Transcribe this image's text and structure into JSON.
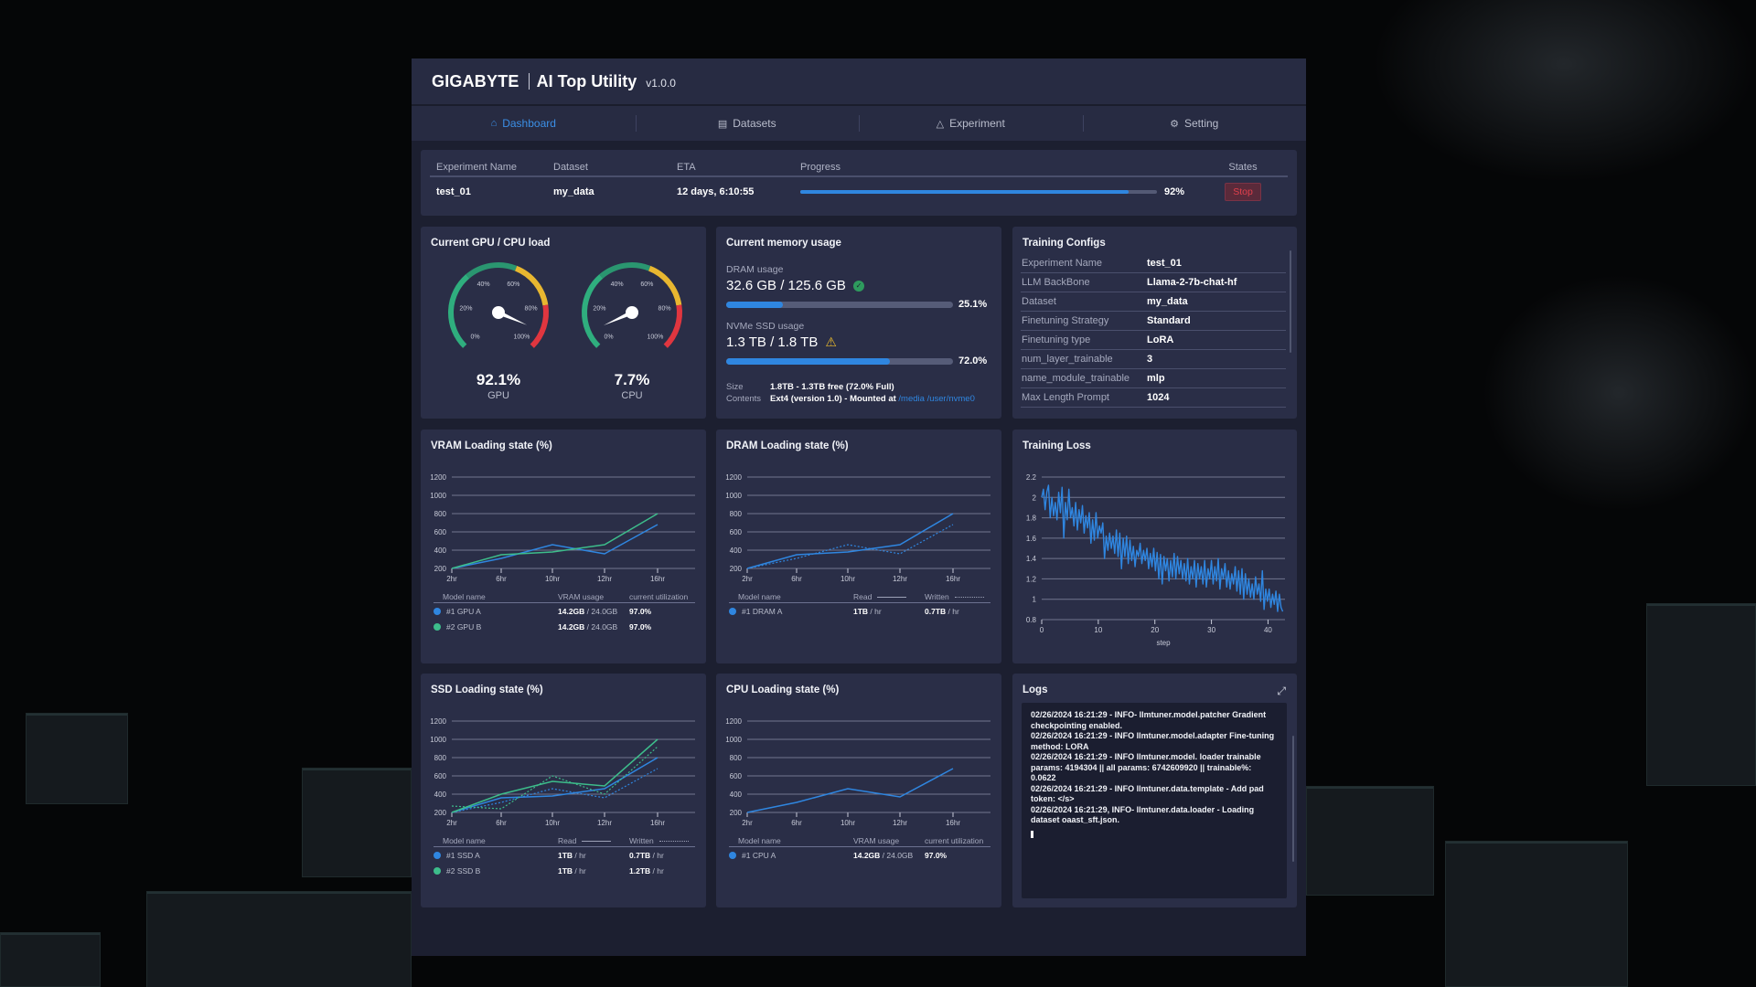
{
  "app": {
    "brand": "GIGABYTE",
    "name": "AI Top Utility",
    "version": "v1.0.0"
  },
  "nav": {
    "tabs": [
      {
        "label": "Dashboard",
        "icon": "home-icon",
        "active": true
      },
      {
        "label": "Datasets",
        "icon": "database-icon",
        "active": false
      },
      {
        "label": "Experiment",
        "icon": "flask-icon",
        "active": false
      },
      {
        "label": "Setting",
        "icon": "gear-icon",
        "active": false
      }
    ]
  },
  "experiment_table": {
    "headers": [
      "Experiment Name",
      "Dataset",
      "ETA",
      "Progress",
      "States"
    ],
    "rows": [
      {
        "name": "test_01",
        "dataset": "my_data",
        "eta": "12 days, 6:10:55",
        "progress": 92,
        "progress_label": "92%",
        "state_button": "Stop"
      }
    ]
  },
  "load": {
    "title": "Current GPU / CPU load",
    "tick_labels": [
      "0%",
      "20%",
      "40%",
      "60%",
      "80%",
      "100%"
    ],
    "gauges": [
      {
        "label": "GPU",
        "value": 92.1,
        "value_label": "92.1%"
      },
      {
        "label": "CPU",
        "value": 7.7,
        "value_label": "7.7%"
      }
    ]
  },
  "memory": {
    "title": "Current memory usage",
    "dram": {
      "label": "DRAM usage",
      "value": "32.6 GB / 125.6 GB",
      "percent": 25.1,
      "percent_label": "25.1%",
      "status": "ok"
    },
    "ssd": {
      "label": "NVMe SSD usage",
      "value": "1.3 TB / 1.8 TB",
      "percent": 72.0,
      "percent_label": "72.0%",
      "status": "warning"
    },
    "size_key": "Size",
    "size_value": "1.8TB - 1.3TB free (72.0% Full)",
    "contents_key": "Contents",
    "contents_value": "Ext4 (version 1.0) - Mounted at ",
    "contents_link": "/media /user/nvme0"
  },
  "configs": {
    "title": "Training Configs",
    "rows": [
      {
        "key": "Experiment Name",
        "value": "test_01"
      },
      {
        "key": "LLM BackBone",
        "value": "Llama-2-7b-chat-hf"
      },
      {
        "key": "Dataset",
        "value": "my_data"
      },
      {
        "key": "Finetuning Strategy",
        "value": "Standard"
      },
      {
        "key": "Finetuning type",
        "value": "LoRA"
      },
      {
        "key": "num_layer_trainable",
        "value": "3"
      },
      {
        "key": "name_module_trainable",
        "value": "mlp"
      },
      {
        "key": "Max Length Prompt",
        "value": "1024"
      }
    ]
  },
  "colors": {
    "blue": "#2f86e0",
    "green": "#3dbd8b",
    "gauge_green": "#2fae7e",
    "gauge_yellow": "#e8b730",
    "gauge_red": "#e0363f",
    "stop_red": "#e0404c"
  },
  "chart_data": [
    {
      "id": "vram",
      "type": "line",
      "title": "VRAM Loading state (%)",
      "categories": [
        "2hr",
        "6hr",
        "10hr",
        "12hr",
        "16hr"
      ],
      "yticks": [
        200,
        400,
        600,
        800,
        1000,
        1200
      ],
      "ylim": [
        200,
        1200
      ],
      "grid": true,
      "series": [
        {
          "name": "GPU A",
          "color": "#2f86e0",
          "style": "solid",
          "values": [
            200,
            310,
            460,
            360,
            680
          ]
        },
        {
          "name": "GPU B",
          "color": "#3dbd8b",
          "style": "solid",
          "values": [
            200,
            350,
            380,
            460,
            800
          ]
        }
      ],
      "legend": {
        "headers": [
          "Model name",
          "VRAM usage",
          "current utilization"
        ],
        "rows": [
          {
            "index": "#1",
            "name": "GPU A",
            "color": "#2f86e0",
            "c2_bold": "14.2GB",
            "c2_rest": " / 24.0GB",
            "c3_bold": "97.0%",
            "c3_rest": ""
          },
          {
            "index": "#2",
            "name": "GPU B",
            "color": "#3dbd8b",
            "c2_bold": "14.2GB",
            "c2_rest": " / 24.0GB",
            "c3_bold": "97.0%",
            "c3_rest": ""
          }
        ]
      }
    },
    {
      "id": "dram",
      "type": "line",
      "title": "DRAM Loading state (%)",
      "categories": [
        "2hr",
        "6hr",
        "10hr",
        "12hr",
        "16hr"
      ],
      "yticks": [
        200,
        400,
        600,
        800,
        1000,
        1200
      ],
      "ylim": [
        200,
        1200
      ],
      "grid": true,
      "series": [
        {
          "name": "DRAM A Read",
          "color": "#2f86e0",
          "style": "solid",
          "values": [
            200,
            350,
            380,
            460,
            800
          ]
        },
        {
          "name": "DRAM A Written",
          "color": "#2f86e0",
          "style": "dashed",
          "values": [
            200,
            310,
            460,
            360,
            680
          ]
        }
      ],
      "legend": {
        "headers": [
          "Model name",
          "Read",
          "Written"
        ],
        "line_samples": true,
        "rows": [
          {
            "index": "#1",
            "name": "DRAM A",
            "color": "#2f86e0",
            "c2_bold": "1TB",
            "c2_rest": " / hr",
            "c3_bold": "0.7TB",
            "c3_rest": " / hr"
          }
        ]
      }
    },
    {
      "id": "loss",
      "type": "line",
      "title": "Training Loss",
      "xlabel": "step",
      "xticks": [
        0,
        10,
        20,
        30,
        40
      ],
      "xlim": [
        0,
        43
      ],
      "yticks": [
        0.8,
        1,
        1.2,
        1.4,
        1.6,
        1.8,
        2,
        2.2
      ],
      "ylim": [
        0.8,
        2.2
      ],
      "grid": true,
      "series": [
        {
          "name": "loss",
          "color": "#2f86e0",
          "style": "solid",
          "x": [
            0,
            0.3,
            0.6,
            0.9,
            1.2,
            1.5,
            1.8,
            2.1,
            2.4,
            2.7,
            3.0,
            3.3,
            3.6,
            3.9,
            4.2,
            4.5,
            4.8,
            5.1,
            5.4,
            5.7,
            6.0,
            6.3,
            6.6,
            6.9,
            7.2,
            7.5,
            7.8,
            8.1,
            8.4,
            8.7,
            9.0,
            9.3,
            9.6,
            9.9,
            10.2,
            10.5,
            10.8,
            11.1,
            11.4,
            11.7,
            12.0,
            12.3,
            12.6,
            12.9,
            13.2,
            13.5,
            13.8,
            14.1,
            14.4,
            14.7,
            15.0,
            15.3,
            15.6,
            15.9,
            16.2,
            16.5,
            16.8,
            17.1,
            17.4,
            17.7,
            18.0,
            18.3,
            18.6,
            18.9,
            19.2,
            19.5,
            19.8,
            20.1,
            20.4,
            20.7,
            21.0,
            21.3,
            21.6,
            21.9,
            22.2,
            22.5,
            22.8,
            23.1,
            23.4,
            23.7,
            24.0,
            24.3,
            24.6,
            24.9,
            25.2,
            25.5,
            25.8,
            26.1,
            26.4,
            26.7,
            27.0,
            27.3,
            27.6,
            27.9,
            28.2,
            28.5,
            28.8,
            29.1,
            29.4,
            29.7,
            30.0,
            30.3,
            30.6,
            30.9,
            31.2,
            31.5,
            31.8,
            32.1,
            32.4,
            32.7,
            33.0,
            33.3,
            33.6,
            33.9,
            34.2,
            34.5,
            34.8,
            35.1,
            35.4,
            35.7,
            36.0,
            36.3,
            36.6,
            36.9,
            37.2,
            37.5,
            37.8,
            38.1,
            38.4,
            38.7,
            39.0,
            39.3,
            39.6,
            39.9,
            40.2,
            40.5,
            40.8,
            41.1,
            41.4,
            41.7,
            42.0,
            42.3,
            42.6,
            42.9,
            43.0
          ],
          "values": [
            2.0,
            2.08,
            1.88,
            2.05,
            2.12,
            1.8,
            2.0,
            1.82,
            1.95,
            1.78,
            2.05,
            1.85,
            2.1,
            1.6,
            1.95,
            1.78,
            2.08,
            1.8,
            1.9,
            1.72,
            1.95,
            1.68,
            1.88,
            1.75,
            1.92,
            1.65,
            1.82,
            1.7,
            1.85,
            1.55,
            1.78,
            1.58,
            1.85,
            1.6,
            1.72,
            1.65,
            1.75,
            1.4,
            1.62,
            1.48,
            1.65,
            1.5,
            1.62,
            1.45,
            1.68,
            1.42,
            1.65,
            1.3,
            1.6,
            1.42,
            1.62,
            1.35,
            1.58,
            1.38,
            1.52,
            1.32,
            1.48,
            1.42,
            1.55,
            1.35,
            1.48,
            1.38,
            1.5,
            1.3,
            1.45,
            1.32,
            1.5,
            1.28,
            1.46,
            1.2,
            1.44,
            1.15,
            1.42,
            1.28,
            1.4,
            1.18,
            1.38,
            1.22,
            1.45,
            1.2,
            1.42,
            1.25,
            1.38,
            1.2,
            1.35,
            1.18,
            1.4,
            1.15,
            1.32,
            1.2,
            1.38,
            1.12,
            1.35,
            1.2,
            1.32,
            1.15,
            1.38,
            1.12,
            1.3,
            1.2,
            1.38,
            1.15,
            1.32,
            1.18,
            1.4,
            1.1,
            1.3,
            1.2,
            1.35,
            1.12,
            1.28,
            1.1,
            1.25,
            1.15,
            1.32,
            1.08,
            1.28,
            1.05,
            1.3,
            1.0,
            1.25,
            1.05,
            1.2,
            1.02,
            1.15,
            1.0,
            1.22,
            1.05,
            1.15,
            0.98,
            1.28,
            0.9,
            1.1,
            0.98,
            1.1,
            0.92,
            1.05,
            0.95,
            1.08,
            0.88,
            1.05,
            0.92,
            0.88
          ]
        }
      ]
    },
    {
      "id": "ssd",
      "type": "line",
      "title": "SSD Loading state (%)",
      "categories": [
        "2hr",
        "6hr",
        "10hr",
        "12hr",
        "16hr"
      ],
      "yticks": [
        200,
        400,
        600,
        800,
        1000,
        1200
      ],
      "ylim": [
        200,
        1200
      ],
      "grid": true,
      "series": [
        {
          "name": "SSD A Read",
          "color": "#2f86e0",
          "style": "solid",
          "values": [
            200,
            360,
            380,
            460,
            800
          ]
        },
        {
          "name": "SSD A Written",
          "color": "#2f86e0",
          "style": "dashed",
          "values": [
            200,
            310,
            460,
            360,
            680
          ]
        },
        {
          "name": "SSD B Read",
          "color": "#3dbd8b",
          "style": "solid",
          "values": [
            200,
            400,
            540,
            490,
            1000
          ]
        },
        {
          "name": "SSD B Written",
          "color": "#3dbd8b",
          "style": "dashed",
          "values": [
            270,
            240,
            600,
            400,
            920
          ]
        }
      ],
      "legend": {
        "headers": [
          "Model name",
          "Read",
          "Written"
        ],
        "line_samples": true,
        "rows": [
          {
            "index": "#1",
            "name": "SSD A",
            "color": "#2f86e0",
            "c2_bold": "1TB",
            "c2_rest": " / hr",
            "c3_bold": "0.7TB",
            "c3_rest": " / hr"
          },
          {
            "index": "#2",
            "name": "SSD B",
            "color": "#3dbd8b",
            "c2_bold": "1TB",
            "c2_rest": " / hr",
            "c3_bold": "1.2TB",
            "c3_rest": " / hr"
          }
        ]
      }
    },
    {
      "id": "cpu",
      "type": "line",
      "title": "CPU Loading state (%)",
      "categories": [
        "2hr",
        "6hr",
        "10hr",
        "12hr",
        "16hr"
      ],
      "yticks": [
        200,
        400,
        600,
        800,
        1000,
        1200
      ],
      "ylim": [
        200,
        1200
      ],
      "grid": true,
      "series": [
        {
          "name": "CPU A",
          "color": "#2f86e0",
          "style": "solid",
          "values": [
            200,
            310,
            460,
            370,
            680
          ]
        }
      ],
      "legend": {
        "headers": [
          "Model name",
          "VRAM usage",
          "current utilization"
        ],
        "rows": [
          {
            "index": "#1",
            "name": "CPU A",
            "color": "#2f86e0",
            "c2_bold": "14.2GB",
            "c2_rest": " / 24.0GB",
            "c3_bold": "97.0%",
            "c3_rest": ""
          }
        ]
      }
    }
  ],
  "logs": {
    "title": "Logs",
    "lines": [
      "02/26/2024 16:21:29 -  INFO- llmtuner.model.patcher Gradient checkpointing enabled.",
      "02/26/2024 16:21:29 - INFO llmtuner.model.adapter Fine-tuning method: LORA",
      "02/26/2024 16:21:29 -  INFO llmtuner.model. loader trainable params: 4194304 || all params: 6742609920 || trainable%: 0.0622",
      "02/26/2024 16:21:29 -  INFO llmtuner.data.template - Add pad token: </s>",
      "02/26/2024 16:21:29, INFO- llmtuner.data.loader - Loading dataset oaast_sft.json."
    ]
  }
}
